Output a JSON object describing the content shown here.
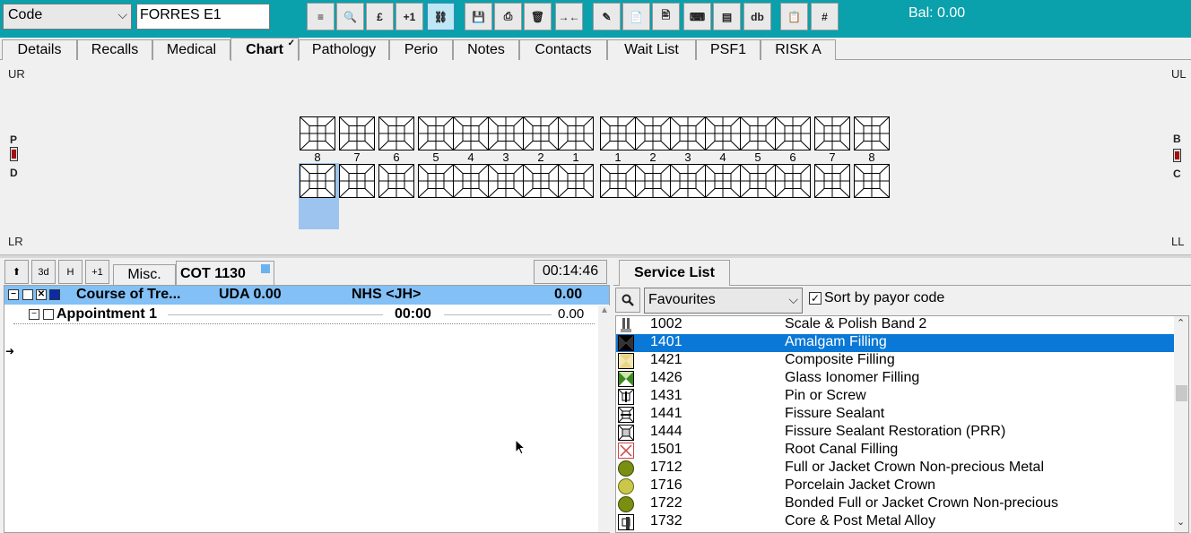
{
  "toolbar": {
    "code_select": "Code",
    "patient_field": "FORRES E1",
    "balance": "Bal: 0.00",
    "buttons": [
      {
        "name": "align-left-icon",
        "label": "≡"
      },
      {
        "name": "search-icon",
        "label": "🔍"
      },
      {
        "name": "pound-icon",
        "label": "£"
      },
      {
        "name": "plus-one-button",
        "label": "+1"
      },
      {
        "name": "link-icon",
        "label": "⛓"
      },
      {
        "name": "save-icon",
        "label": "💾"
      },
      {
        "name": "print-icon",
        "label": "⎙"
      },
      {
        "name": "delete-icon",
        "label": "🗑"
      },
      {
        "name": "collapse-icon",
        "label": "→←"
      },
      {
        "name": "pen-icon",
        "label": "✎"
      },
      {
        "name": "document-icon",
        "label": "📄"
      },
      {
        "name": "scan-icon",
        "label": "🖹"
      },
      {
        "name": "keyboard-icon",
        "label": "⌨"
      },
      {
        "name": "note-icon",
        "label": "▤"
      },
      {
        "name": "database-icon",
        "label": "db"
      },
      {
        "name": "new-document-icon",
        "label": "📋"
      },
      {
        "name": "grid-icon",
        "label": "#"
      }
    ]
  },
  "tabs": [
    {
      "label": "Details"
    },
    {
      "label": "Recalls"
    },
    {
      "label": "Medical"
    },
    {
      "label": "Chart"
    },
    {
      "label": "Pathology"
    },
    {
      "label": "Perio"
    },
    {
      "label": "Notes"
    },
    {
      "label": "Contacts"
    },
    {
      "label": "Wait List"
    },
    {
      "label": "PSF1"
    },
    {
      "label": "RISK A"
    }
  ],
  "chart": {
    "quadrants": {
      "ur": "UR",
      "ul": "UL",
      "lr": "LR",
      "ll": "LL"
    },
    "left_marks": {
      "top": "P",
      "bottom": "D"
    },
    "right_marks": {
      "top": "B",
      "bottom": "C"
    },
    "tooth_numbers": [
      "8",
      "7",
      "6",
      "5",
      "4",
      "3",
      "2",
      "1",
      "1",
      "2",
      "3",
      "4",
      "5",
      "6",
      "7",
      "8"
    ]
  },
  "left_panel": {
    "buttons": [
      "⬆",
      "3d",
      "H",
      "+1"
    ],
    "tabs": {
      "misc": "Misc.",
      "cot": "COT 1130"
    },
    "timer": "00:14:46",
    "course": {
      "title": "Course of Tre...",
      "uda": "UDA 0.00",
      "nhs": "NHS <JH>",
      "amount": "0.00"
    },
    "appointment": {
      "title": "Appointment 1",
      "time": "00:00",
      "amount": "0.00"
    }
  },
  "right_panel": {
    "tab": "Service List",
    "filter": "Favourites",
    "sort_label": "Sort by payor code",
    "sort_checked": true,
    "services": [
      {
        "code": "1002",
        "desc": "Scale & Polish Band 2",
        "icon": "scale-polish-icon"
      },
      {
        "code": "1401",
        "desc": "Amalgam Filling",
        "icon": "amalgam-icon",
        "selected": true
      },
      {
        "code": "1421",
        "desc": "Composite Filling",
        "icon": "composite-icon"
      },
      {
        "code": "1426",
        "desc": "Glass Ionomer Filling",
        "icon": "glass-ionomer-icon"
      },
      {
        "code": "1431",
        "desc": "Pin or Screw",
        "icon": "pin-icon"
      },
      {
        "code": "1441",
        "desc": "Fissure Sealant",
        "icon": "fissure-sealant-icon"
      },
      {
        "code": "1444",
        "desc": "Fissure Sealant Restoration (PRR)",
        "icon": "prr-icon"
      },
      {
        "code": "1501",
        "desc": "Root Canal Filling",
        "icon": "root-canal-icon"
      },
      {
        "code": "1712",
        "desc": "Full or Jacket Crown Non-precious Metal",
        "icon": "crown-metal-icon"
      },
      {
        "code": "1716",
        "desc": "Porcelain Jacket Crown",
        "icon": "porcelain-crown-icon"
      },
      {
        "code": "1722",
        "desc": "Bonded Full or Jacket Crown Non-precious",
        "icon": "bonded-crown-icon"
      },
      {
        "code": "1732",
        "desc": "Core & Post Metal Alloy",
        "icon": "core-post-icon"
      }
    ]
  },
  "colors": {
    "toolbar": "#0aa0ac",
    "course_row": "#82c0f6",
    "selection": "#0a78d6",
    "tooth_highlight": "#9cc4ee",
    "crown_green": "#7a8f12",
    "crown_yellow": "#c9c84a"
  }
}
